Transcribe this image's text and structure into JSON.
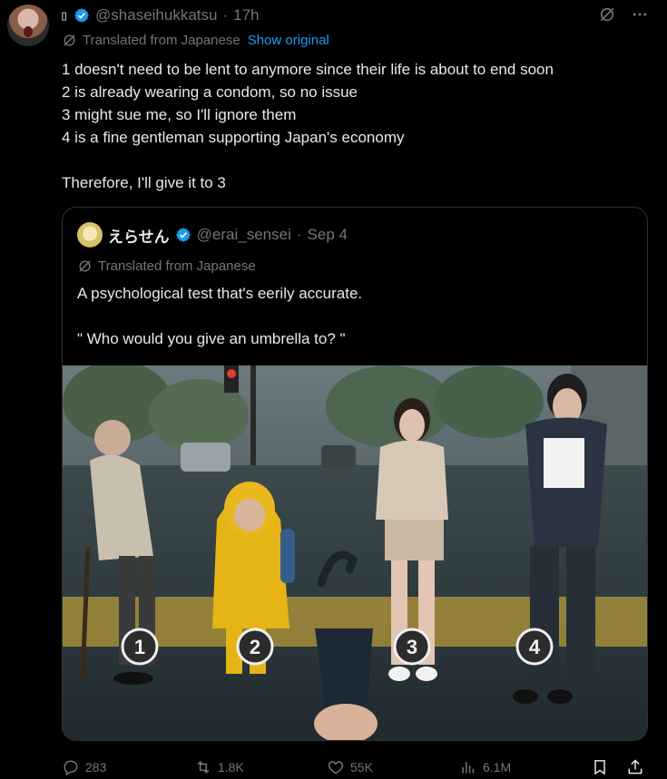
{
  "author": {
    "display_name": "▯",
    "handle": "@shaseihukkatsu",
    "separator": "·",
    "time": "17h",
    "avatar_icon": "avatar-icon"
  },
  "translation": {
    "label": "Translated from Japanese",
    "show_original": "Show original"
  },
  "tweet": {
    "text": "1 doesn't need to be lent to anymore since their life is about to end soon\n2 is already wearing a condom, so no issue\n3 might sue me, so I'll ignore them\n4 is a fine gentleman supporting Japan's economy\n\nTherefore, I'll give it to 3"
  },
  "quote": {
    "display_name": "えらせん",
    "handle": "@erai_sensei",
    "separator": "·",
    "date": "Sep 4",
    "translated_label": "Translated from Japanese",
    "text": "A psychological test that's eerily accurate.\n\n\" Who would you give an umbrella to? \"",
    "image_numbers": [
      "1",
      "2",
      "3",
      "4"
    ]
  },
  "actions": {
    "replies": "283",
    "retweets": "1.8K",
    "likes": "55K",
    "views": "6.1M"
  },
  "colors": {
    "background": "#000000",
    "text": "#e7e9ea",
    "muted": "#71767b",
    "accent": "#1d9bf0",
    "border": "#2f3336"
  }
}
